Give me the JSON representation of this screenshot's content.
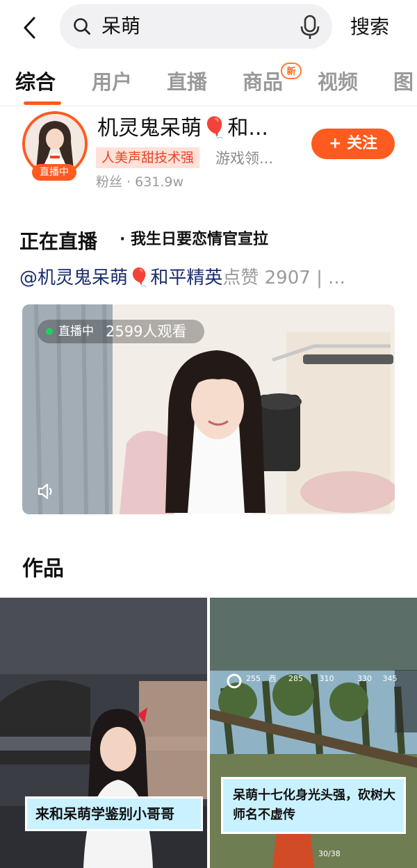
{
  "search": {
    "query": "呆萌",
    "button_label": "搜索"
  },
  "tabs": [
    {
      "label": "综合",
      "active": true
    },
    {
      "label": "用户",
      "active": false
    },
    {
      "label": "直播",
      "active": false
    },
    {
      "label": "商品",
      "active": false,
      "badge": "新"
    },
    {
      "label": "视频",
      "active": false
    },
    {
      "label": "图",
      "active": false
    }
  ],
  "profile": {
    "name": "机灵鬼呆萌🎈和...",
    "live_badge": "直播中",
    "tag": "人美声甜技术强",
    "category": "游戏领...",
    "fans": "粉丝 · 631.9w",
    "follow_label": "+ 关注"
  },
  "live": {
    "heading": "正在直播",
    "title": "· 我生日要恋情官宣拉",
    "anchor": "@机灵鬼呆萌🎈和平精英",
    "likes": "点赞 2907 | ...",
    "status": "直播中",
    "viewers": "2599人观看"
  },
  "works": {
    "heading": "作品",
    "items": [
      {
        "caption": "来和呆萌学鉴别小哥哥"
      },
      {
        "caption": "呆萌十七化身光头强，砍树大师名不虚传"
      }
    ],
    "hud": {
      "compass": [
        "255",
        "西",
        "285",
        "310",
        "330",
        "345"
      ],
      "ammo": "30/38"
    }
  },
  "colors": {
    "accent": "#ff5a1f",
    "link": "#1a2d6b",
    "caption_bg": "#c9f1ff"
  }
}
